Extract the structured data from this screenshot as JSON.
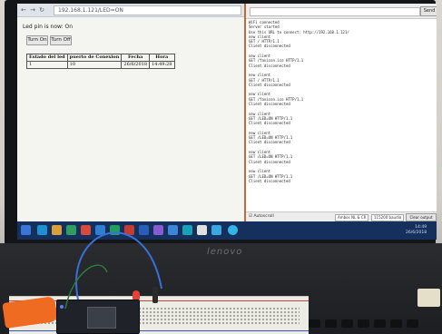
{
  "browser": {
    "url": "192.168.1.121/LED=ON",
    "led_state": "Led pin is now: On",
    "buttons": [
      "Turn On",
      "Turn Off"
    ],
    "table": {
      "headers": [
        "Estado del led",
        "puerto de Conexion",
        "Fecha",
        "Hora"
      ],
      "rows": [
        [
          "1",
          "10",
          "26/6/2018",
          "14:49:28"
        ]
      ]
    }
  },
  "serial": {
    "send_label": "Send",
    "log": [
      "WiFi connected",
      "Server started",
      "Use this URL to connect: http://192.168.1.121/",
      "new client",
      "GET / HTTP/1.1",
      "Client disconnected",
      "",
      "new client",
      "GET /favicon.ico HTTP/1.1",
      "Client disconnected",
      "",
      "new client",
      "GET / HTTP/1.1",
      "Client disconnected",
      "",
      "new client",
      "GET /favicon.ico HTTP/1.1",
      "Client disconnected",
      "",
      "new client",
      "GET /LED=ON HTTP/1.1",
      "Client disconnected",
      "",
      "new client",
      "GET /LED=ON HTTP/1.1",
      "Client disconnected",
      "",
      "new client",
      "GET /LED=ON HTTP/1.1",
      "Client disconnected",
      "",
      "new client",
      "GET /LED=ON HTTP/1.1",
      "Client disconnected"
    ],
    "autoscroll_label": "Autoscroll",
    "line_ending": "Ambos NL & CR",
    "baud": "115200 baudio",
    "clear_label": "Clear output"
  },
  "laptop": {
    "brand": "lenovo"
  },
  "taskbar": {
    "tray_time": "14:49",
    "tray_date": "26/6/2018"
  }
}
